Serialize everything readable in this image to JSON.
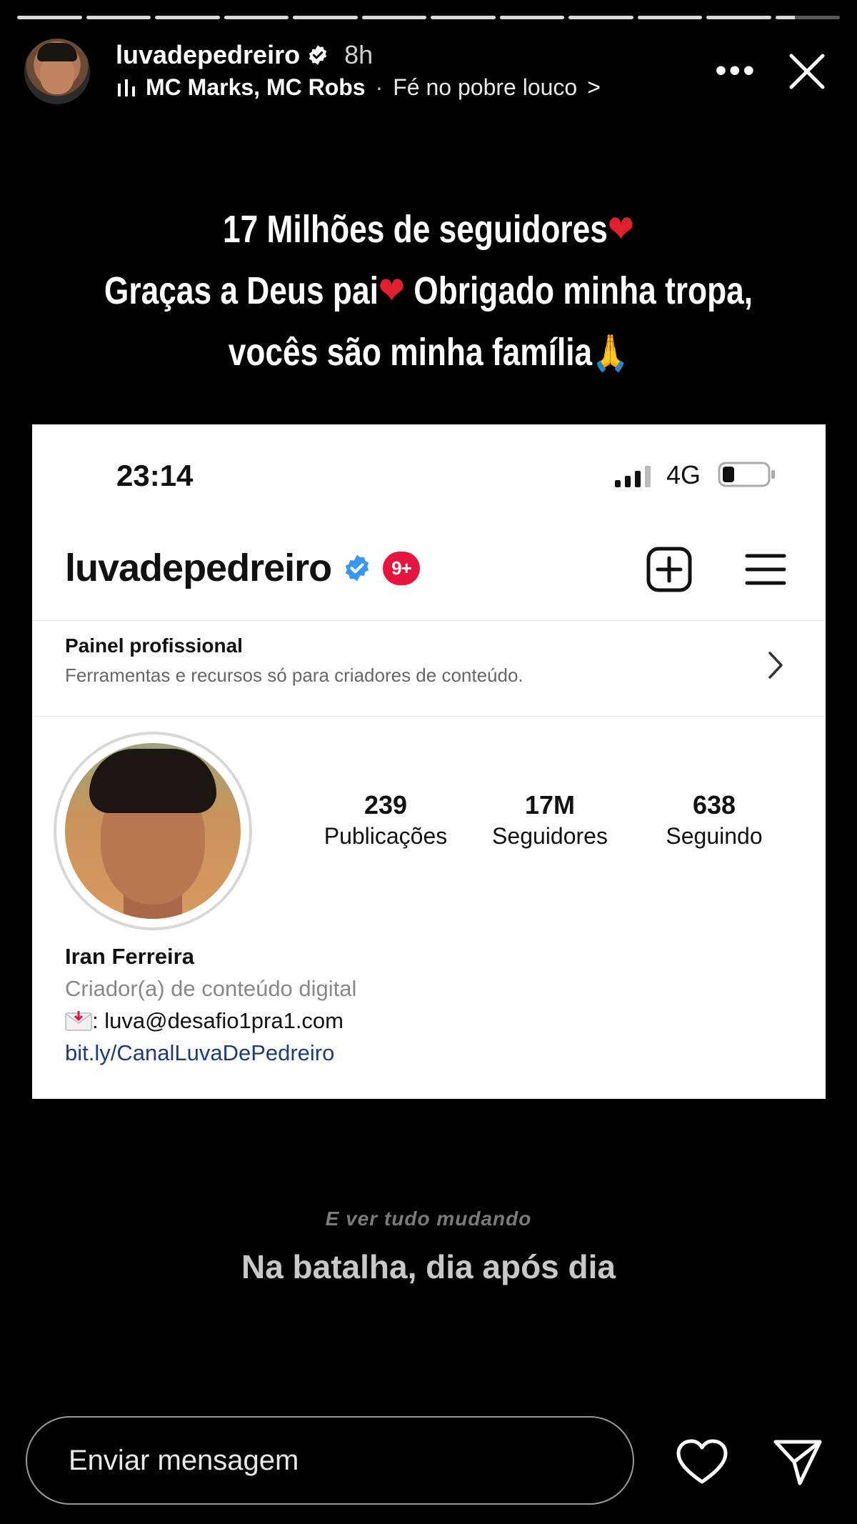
{
  "story": {
    "segments_total": 12,
    "segments_viewed": 11,
    "username": "luvadepedreiro",
    "time_ago": "8h",
    "music": {
      "artists": "MC Marks, MC Robs",
      "separator": "·",
      "song": "Fé no pobre louco",
      "chevron": ">"
    },
    "more_label": "•••"
  },
  "caption": {
    "line1": "17 Milhões de seguidores",
    "line2a": "Graças a Deus pai",
    "line2b": " Obrigado minha tropa,",
    "line3": "vocês são minha família",
    "heart": "❤",
    "pray": "🙏"
  },
  "screenshot": {
    "status": {
      "time": "23:14",
      "network": "4G"
    },
    "profile": {
      "username": "luvadepedreiro",
      "badge": "9+",
      "panel_title": "Painel profissional",
      "panel_sub": "Ferramentas e recursos só para criadores de conteúdo.",
      "stats": [
        {
          "num": "239",
          "label": "Publicações"
        },
        {
          "num": "17M",
          "label": "Seguidores"
        },
        {
          "num": "638",
          "label": "Seguindo"
        }
      ],
      "name": "Iran Ferreira",
      "category": "Criador(a) de conteúdo digital",
      "email_line": ": luva@desafio1pra1.com",
      "link": "bit.ly/CanalLuvaDePedreiro"
    }
  },
  "lyrics": {
    "line1": "E ver tudo mudando",
    "line2": "Na batalha, dia após dia"
  },
  "footer": {
    "message_placeholder": "Enviar mensagem"
  },
  "colors": {
    "background": "#000000",
    "badge_red": "#e5153f",
    "verified_blue": "#3897f0",
    "link_blue": "#1d3c78"
  }
}
